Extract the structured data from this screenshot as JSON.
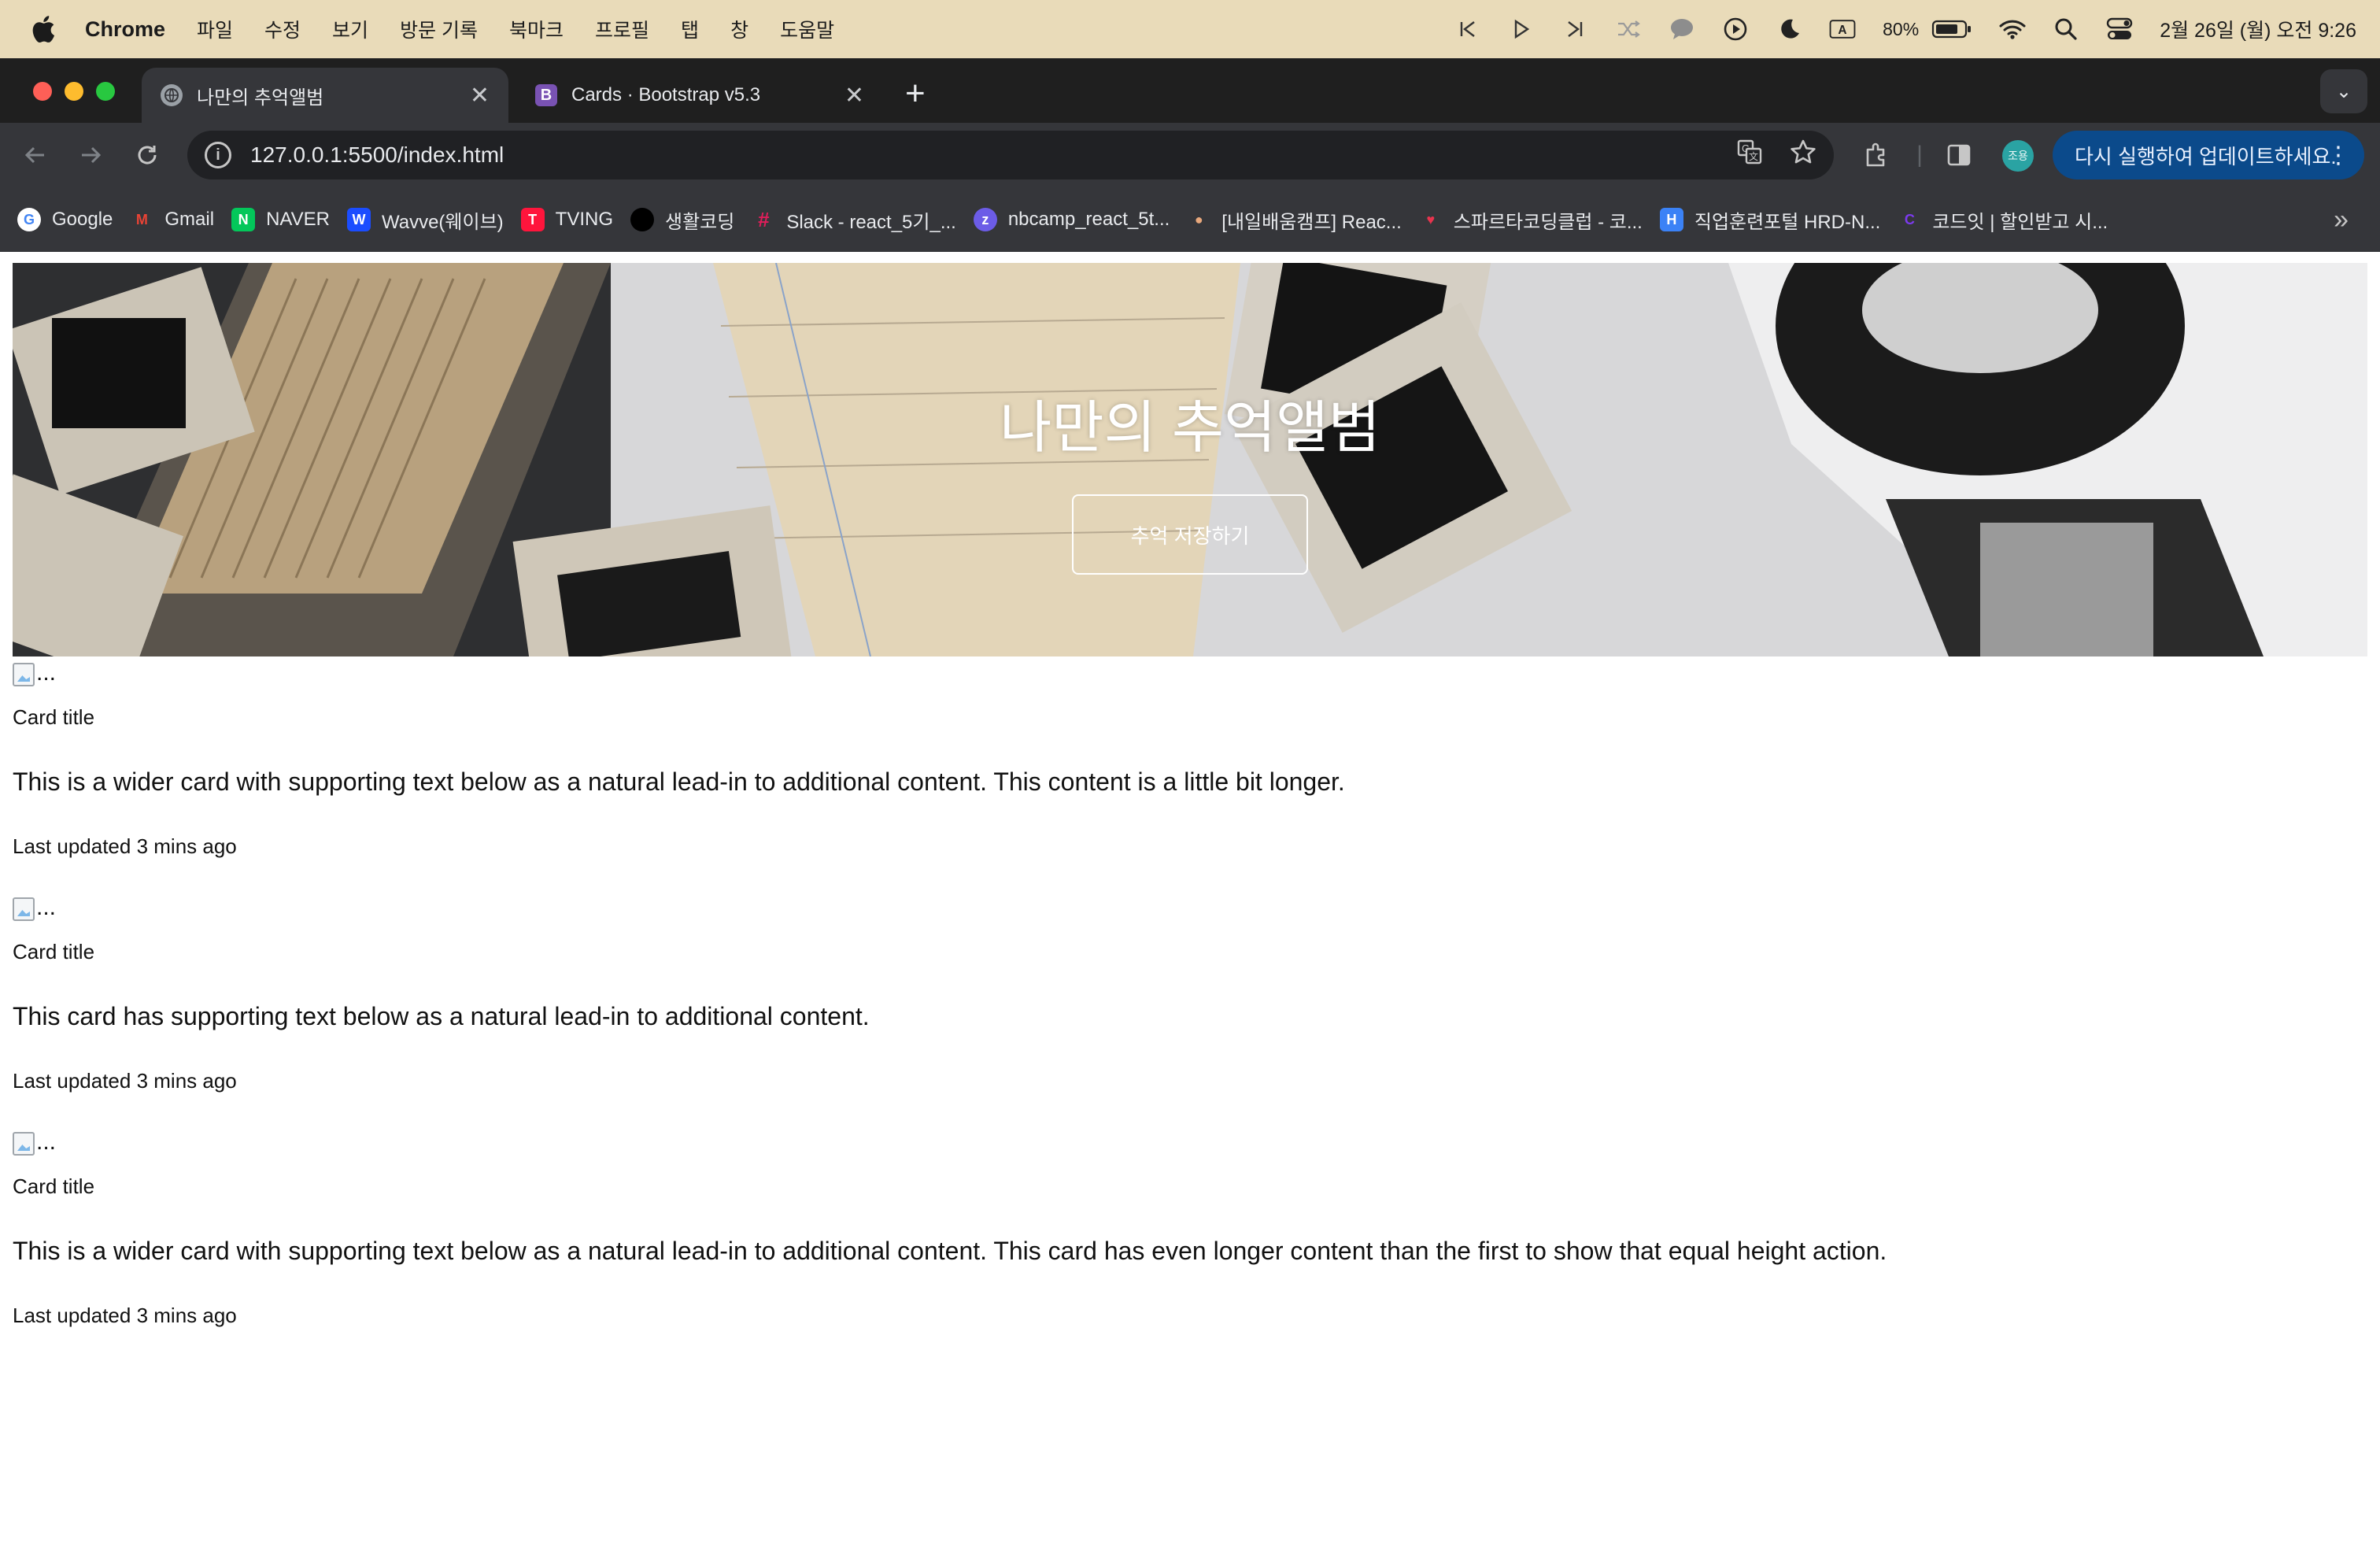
{
  "macos_menubar": {
    "app_name": "Chrome",
    "menus": [
      "파일",
      "수정",
      "보기",
      "방문 기록",
      "북마크",
      "프로필",
      "탭",
      "창",
      "도움말"
    ],
    "battery_percent": "80%",
    "input_indicator": "A",
    "datetime": "2월 26일 (월) 오전 9:26",
    "status_icons": [
      "previous-track-icon",
      "play-icon",
      "next-track-icon",
      "shuffle-icon",
      "message-bubble-icon",
      "play-circle-icon",
      "moon-icon",
      "input-source-icon",
      "battery-icon",
      "wifi-icon",
      "search-icon",
      "control-center-icon"
    ]
  },
  "browser": {
    "tabs": [
      {
        "title": "나만의 추억앨범",
        "active": true,
        "favicon": "globe-icon"
      },
      {
        "title": "Cards · Bootstrap v5.3",
        "active": false,
        "favicon": "bootstrap-icon",
        "favicon_letter": "B"
      }
    ],
    "new_tab_label": "+",
    "url": "127.0.0.1:5500/index.html",
    "profile_initials": "조용",
    "update_button_label": "다시 실행하여 업데이트하세요.",
    "bookmarks": [
      {
        "label": "Google",
        "icon": "google-icon",
        "color": "#ffffff",
        "letter": "G"
      },
      {
        "label": "Gmail",
        "icon": "gmail-icon",
        "color": "#ea4335",
        "letter": "M"
      },
      {
        "label": "NAVER",
        "icon": "naver-icon",
        "color": "#03c75a",
        "letter": "N"
      },
      {
        "label": "Wavve(웨이브)",
        "icon": "wavve-icon",
        "color": "#1b4dff",
        "letter": "W"
      },
      {
        "label": "TVING",
        "icon": "tving-icon",
        "color": "#ff153c",
        "letter": "T"
      },
      {
        "label": "생활코딩",
        "icon": "circle-icon",
        "color": "#000000",
        "letter": ""
      },
      {
        "label": "Slack - react_5기_...",
        "icon": "slack-icon",
        "color": "#4a154b",
        "letter": "#"
      },
      {
        "label": "nbcamp_react_5t...",
        "icon": "zep-icon",
        "color": "#6c5ce7",
        "letter": "z"
      },
      {
        "label": "[내일배움캠프] Reac...",
        "icon": "camp-icon",
        "color": "#222222",
        "letter": "●"
      },
      {
        "label": "스파르타코딩클럽 - 코...",
        "icon": "sparta-icon",
        "color": "#e8344e",
        "letter": "♥"
      },
      {
        "label": "직업훈련포털 HRD-N...",
        "icon": "hrd-icon",
        "color": "#3b82f6",
        "letter": "H"
      },
      {
        "label": "코드잇 | 할인받고 시...",
        "icon": "codeit-icon",
        "color": "#7c3aed",
        "letter": "C"
      }
    ]
  },
  "page": {
    "hero": {
      "title": "나만의 추억앨범",
      "button_label": "추억 저장하기"
    },
    "cards": [
      {
        "img_alt": "...",
        "title": "Card title",
        "text": "This is a wider card with supporting text below as a natural lead-in to additional content. This content is a little bit longer.",
        "updated": "Last updated 3 mins ago"
      },
      {
        "img_alt": "...",
        "title": "Card title",
        "text": "This card has supporting text below as a natural lead-in to additional content.",
        "updated": "Last updated 3 mins ago"
      },
      {
        "img_alt": "...",
        "title": "Card title",
        "text": "This is a wider card with supporting text below as a natural lead-in to additional content. This card has even longer content than the first to show that equal height action.",
        "updated": "Last updated 3 mins ago"
      }
    ]
  },
  "colors": {
    "menubar_bg": "#e9dbb9",
    "chrome_dark": "#35363a",
    "update_button_bg": "#0b4a8b"
  }
}
